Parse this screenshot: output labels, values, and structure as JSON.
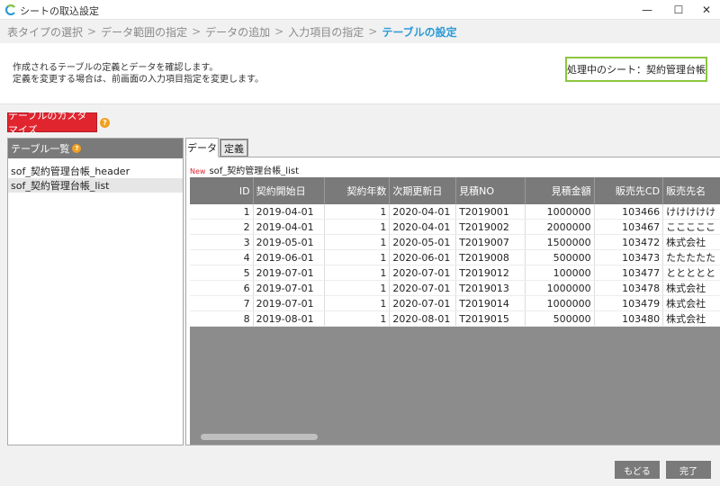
{
  "window": {
    "title": "シートの取込設定",
    "minimize": "—",
    "maximize": "☐",
    "close": "✕"
  },
  "breadcrumb": [
    "表タイプの選択",
    "データ範囲の指定",
    "データの追加",
    "入力項目の指定",
    "テーブルの設定"
  ],
  "breadcrumb_sep": ">",
  "info": {
    "line1": "作成されるテーブルの定義とデータを確認します。",
    "line2": "定義を変更する場合は、前画面の入力項目指定を変更します。",
    "sheet": "処理中のシート：契約管理台帳"
  },
  "customize_button": "テーブルのカスタマイズ",
  "help_glyph": "?",
  "left_panel": {
    "header": "テーブル一覧",
    "items": [
      "sof_契約管理台帳_header",
      "sof_契約管理台帳_list"
    ],
    "selected_index": 1
  },
  "tabs": {
    "data": "データ",
    "definition": "定義"
  },
  "table": {
    "new_badge": "New",
    "name": "sof_契約管理台帳_list",
    "columns": [
      "ID",
      "契約開始日",
      "契約年数",
      "次期更新日",
      "見積NO",
      "見積金額",
      "販売先CD",
      "販売先名"
    ],
    "rows": [
      [
        "1",
        "2019-04-01",
        "1",
        "2020-04-01",
        "T2019001",
        "1000000",
        "103466",
        "けけけけけ"
      ],
      [
        "2",
        "2019-04-01",
        "1",
        "2020-04-01",
        "T2019002",
        "2000000",
        "103467",
        "こここここ"
      ],
      [
        "3",
        "2019-05-01",
        "1",
        "2020-05-01",
        "T2019007",
        "1500000",
        "103472",
        "株式会社"
      ],
      [
        "4",
        "2019-06-01",
        "1",
        "2020-06-01",
        "T2019008",
        "500000",
        "103473",
        "たたたたた"
      ],
      [
        "5",
        "2019-07-01",
        "1",
        "2020-07-01",
        "T2019012",
        "100000",
        "103477",
        "ととととと"
      ],
      [
        "6",
        "2019-07-01",
        "1",
        "2020-07-01",
        "T2019013",
        "1000000",
        "103478",
        "株式会社"
      ],
      [
        "7",
        "2019-07-01",
        "1",
        "2020-07-01",
        "T2019014",
        "1000000",
        "103479",
        "株式会社"
      ],
      [
        "8",
        "2019-08-01",
        "1",
        "2020-08-01",
        "T2019015",
        "500000",
        "103480",
        "株式会社"
      ]
    ]
  },
  "footer": {
    "back": "もどる",
    "done": "完了"
  },
  "colors": {
    "accent": "#2b9bd6",
    "sheet_border": "#8cc63f",
    "danger": "#e0252f",
    "help": "#f0a020"
  }
}
